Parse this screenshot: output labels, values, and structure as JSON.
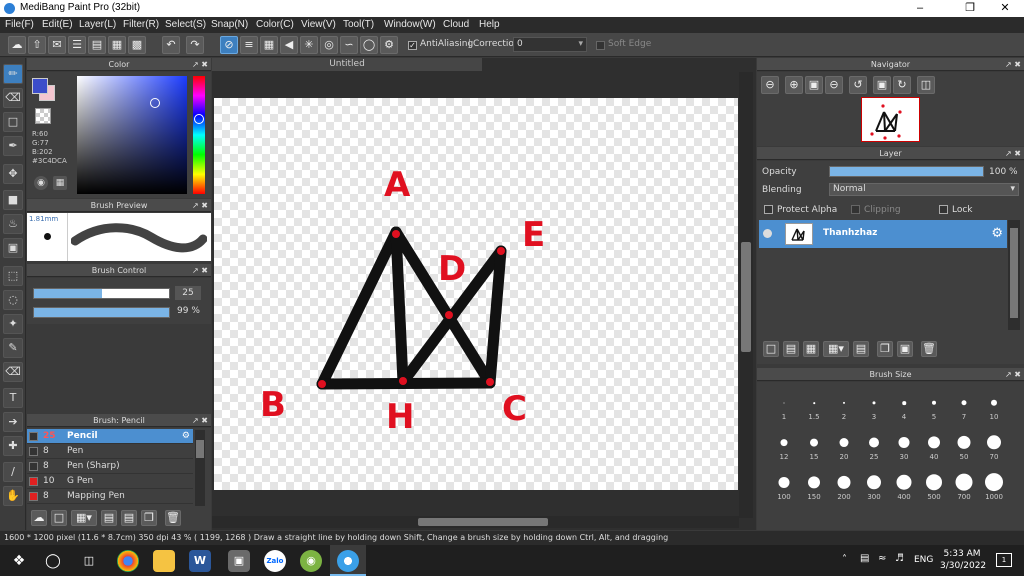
{
  "window": {
    "title": "MediBang Paint Pro (32bit)"
  },
  "menu": [
    "File(F)",
    "Edit(E)",
    "Layer(L)",
    "Filter(R)",
    "Select(S)",
    "Snap(N)",
    "Color(C)",
    "View(V)",
    "Tool(T)",
    "Window(W)",
    "Cloud",
    "Help"
  ],
  "toolbar": {
    "antialiasing_label": "AntiAliasing",
    "correction_label": "Correction",
    "correction_value": "0",
    "soft_edge_label": "Soft Edge"
  },
  "color_panel": {
    "title": "Color",
    "r": "R:60",
    "g": "G:77",
    "b": "B:202",
    "hex": "#3C4DCA",
    "primary_color": "#3c4dca",
    "secondary_color": "#f5c6d0"
  },
  "brush_preview": {
    "title": "Brush Preview",
    "size": "1.81mm"
  },
  "brush_control": {
    "title": "Brush Control",
    "size_value": "25",
    "opacity_value": "99 %"
  },
  "brush_list": {
    "title": "Brush: Pencil",
    "items": [
      {
        "size": "25",
        "name": "Pencil",
        "color": "#333333",
        "selected": true
      },
      {
        "size": "8",
        "name": "Pen",
        "color": "#333333"
      },
      {
        "size": "8",
        "name": "Pen (Sharp)",
        "color": "#333333"
      },
      {
        "size": "10",
        "name": "G Pen",
        "color": "#e02020"
      },
      {
        "size": "8",
        "name": "Mapping Pen",
        "color": "#e02020"
      }
    ]
  },
  "document": {
    "tab": "Untitled"
  },
  "drawing": {
    "labels": [
      "A",
      "B",
      "C",
      "D",
      "E",
      "H"
    ],
    "stroke_color": "#111111",
    "label_color": "#e01020",
    "point_color": "#e01020"
  },
  "navigator": {
    "title": "Navigator"
  },
  "layer_panel": {
    "title": "Layer",
    "opacity_label": "Opacity",
    "opacity_value": "100 %",
    "blending_label": "Blending",
    "blending_value": "Normal",
    "protect_alpha": "Protect Alpha",
    "clipping": "Clipping",
    "lock": "Lock",
    "layer_name": "Thanhzhaz"
  },
  "brush_size": {
    "title": "Brush Size",
    "sizes": [
      "1",
      "1.5",
      "2",
      "3",
      "4",
      "5",
      "7",
      "10",
      "12",
      "15",
      "20",
      "25",
      "30",
      "40",
      "50",
      "70",
      "100",
      "150",
      "200",
      "300",
      "400",
      "500",
      "700",
      "1000"
    ]
  },
  "statusbar": {
    "text": "1600 * 1200 pixel   (11.6 * 8.7cm)   350 dpi   43 %   ( 1199, 1268 )   Draw a straight line by holding down Shift, Change a brush size by holding down Ctrl, Alt, and dragging"
  },
  "taskbar": {
    "lang": "ENG",
    "time": "5:33 AM",
    "date": "3/30/2022",
    "notif": "1"
  }
}
